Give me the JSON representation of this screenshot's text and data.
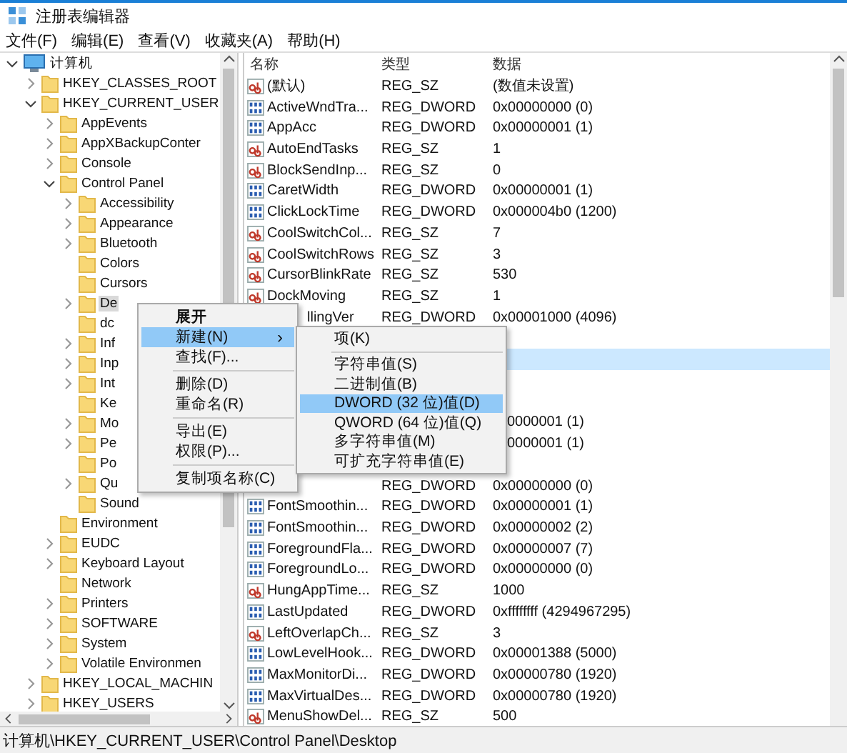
{
  "window": {
    "title": "注册表编辑器"
  },
  "menu_bar": [
    "文件(F)",
    "编辑(E)",
    "查看(V)",
    "收藏夹(A)",
    "帮助(H)"
  ],
  "tree": [
    {
      "label": "计算机",
      "kind": "computer",
      "expandable": true,
      "expanded": true,
      "selected": false,
      "children": [
        {
          "label": "HKEY_CLASSES_ROOT",
          "expandable": true,
          "expanded": false,
          "selected": false
        },
        {
          "label": "HKEY_CURRENT_USER",
          "expandable": true,
          "expanded": true,
          "selected": false,
          "children": [
            {
              "label": "AppEvents",
              "expandable": true,
              "expanded": false,
              "selected": false
            },
            {
              "label": "AppXBackupConter",
              "expandable": true,
              "expanded": false,
              "selected": false
            },
            {
              "label": "Console",
              "expandable": true,
              "expanded": false,
              "selected": false
            },
            {
              "label": "Control Panel",
              "expandable": true,
              "expanded": true,
              "selected": false,
              "children": [
                {
                  "label": "Accessibility",
                  "expandable": true,
                  "expanded": false,
                  "selected": false
                },
                {
                  "label": "Appearance",
                  "expandable": true,
                  "expanded": false,
                  "selected": false
                },
                {
                  "label": "Bluetooth",
                  "expandable": true,
                  "expanded": false,
                  "selected": false
                },
                {
                  "label": "Colors",
                  "expandable": false,
                  "selected": false
                },
                {
                  "label": "Cursors",
                  "expandable": false,
                  "selected": false
                },
                {
                  "label": "De",
                  "expandable": true,
                  "expanded": false,
                  "selected": true
                },
                {
                  "label": "dc",
                  "expandable": false,
                  "selected": false
                },
                {
                  "label": "Inf",
                  "expandable": true,
                  "expanded": false,
                  "selected": false
                },
                {
                  "label": "Inp",
                  "expandable": true,
                  "expanded": false,
                  "selected": false
                },
                {
                  "label": "Int",
                  "expandable": true,
                  "expanded": false,
                  "selected": false
                },
                {
                  "label": "Ke",
                  "expandable": false,
                  "selected": false
                },
                {
                  "label": "Mo",
                  "expandable": true,
                  "expanded": false,
                  "selected": false
                },
                {
                  "label": "Pe",
                  "expandable": true,
                  "expanded": false,
                  "selected": false
                },
                {
                  "label": "Po",
                  "expandable": false,
                  "selected": false
                },
                {
                  "label": "Qu",
                  "expandable": true,
                  "expanded": false,
                  "selected": false
                },
                {
                  "label": "Sound",
                  "expandable": false,
                  "selected": false
                }
              ]
            },
            {
              "label": "Environment",
              "expandable": false,
              "selected": false
            },
            {
              "label": "EUDC",
              "expandable": true,
              "expanded": false,
              "selected": false
            },
            {
              "label": "Keyboard Layout",
              "expandable": true,
              "expanded": false,
              "selected": false
            },
            {
              "label": "Network",
              "expandable": false,
              "selected": false
            },
            {
              "label": "Printers",
              "expandable": true,
              "expanded": false,
              "selected": false
            },
            {
              "label": "SOFTWARE",
              "expandable": true,
              "expanded": false,
              "selected": false
            },
            {
              "label": "System",
              "expandable": true,
              "expanded": false,
              "selected": false
            },
            {
              "label": "Volatile Environmen",
              "expandable": true,
              "expanded": false,
              "selected": false
            }
          ]
        },
        {
          "label": "HKEY_LOCAL_MACHIN",
          "expandable": true,
          "expanded": false,
          "selected": false
        },
        {
          "label": "HKEY_USERS",
          "expandable": true,
          "expanded": false,
          "selected": false
        }
      ]
    }
  ],
  "table": {
    "columns": [
      "名称",
      "类型",
      "数据"
    ],
    "rows": [
      {
        "kind": "string",
        "name": "(默认)",
        "type": "REG_SZ",
        "data": "(数值未设置)",
        "under_menu": false,
        "under_submenu": false,
        "selected": false
      },
      {
        "kind": "binary",
        "name": "ActiveWndTra...",
        "type": "REG_DWORD",
        "data": "0x00000000 (0)",
        "under_menu": false,
        "under_submenu": false,
        "selected": false
      },
      {
        "kind": "binary",
        "name": "AppAcc",
        "type": "REG_DWORD",
        "data": "0x00000001 (1)",
        "under_menu": false,
        "under_submenu": false,
        "selected": false
      },
      {
        "kind": "string",
        "name": "AutoEndTasks",
        "type": "REG_SZ",
        "data": "1",
        "under_menu": false,
        "under_submenu": false,
        "selected": false
      },
      {
        "kind": "string",
        "name": "BlockSendInp...",
        "type": "REG_SZ",
        "data": "0",
        "under_menu": false,
        "under_submenu": false,
        "selected": false
      },
      {
        "kind": "binary",
        "name": "CaretWidth",
        "type": "REG_DWORD",
        "data": "0x00000001 (1)",
        "under_menu": false,
        "under_submenu": false,
        "selected": false
      },
      {
        "kind": "binary",
        "name": "ClickLockTime",
        "type": "REG_DWORD",
        "data": "0x000004b0 (1200)",
        "under_menu": false,
        "under_submenu": false,
        "selected": false
      },
      {
        "kind": "string",
        "name": "CoolSwitchCol...",
        "type": "REG_SZ",
        "data": "7",
        "under_menu": false,
        "under_submenu": false,
        "selected": false
      },
      {
        "kind": "string",
        "name": "CoolSwitchRows",
        "type": "REG_SZ",
        "data": "3",
        "under_menu": false,
        "under_submenu": false,
        "selected": false
      },
      {
        "kind": "string",
        "name": "CursorBlinkRate",
        "type": "REG_SZ",
        "data": "530",
        "under_menu": false,
        "under_submenu": false,
        "selected": false
      },
      {
        "kind": "string",
        "name": "DockMoving",
        "type": "REG_SZ",
        "data": "1",
        "under_menu": false,
        "under_submenu": false,
        "selected": false
      },
      {
        "name": "llingVer",
        "type": "REG_DWORD",
        "data": "0x00001000 (4096)",
        "under_menu": true,
        "under_submenu": false,
        "selected": false
      },
      {
        "selected": false
      },
      {
        "selected": true
      },
      {
        "selected": false
      },
      {
        "selected": false
      },
      {
        "data": "0000001 (1)",
        "under_submenu": true,
        "selected": false
      },
      {
        "data": "0000001 (1)",
        "under_submenu": true,
        "selected": false
      },
      {
        "selected": false
      },
      {
        "type": "REG_DWORD",
        "data": "0x00000000 (0)",
        "under_submenu": false,
        "selected": false
      },
      {
        "kind": "binary",
        "name": "FontSmoothin...",
        "type": "REG_DWORD",
        "data": "0x00000001 (1)",
        "under_menu": false,
        "under_submenu": false,
        "selected": false
      },
      {
        "kind": "binary",
        "name": "FontSmoothin...",
        "type": "REG_DWORD",
        "data": "0x00000002 (2)",
        "under_menu": false,
        "under_submenu": false,
        "selected": false
      },
      {
        "kind": "binary",
        "name": "ForegroundFla...",
        "type": "REG_DWORD",
        "data": "0x00000007 (7)",
        "under_menu": false,
        "under_submenu": false,
        "selected": false
      },
      {
        "kind": "binary",
        "name": "ForegroundLo...",
        "type": "REG_DWORD",
        "data": "0x00000000 (0)",
        "under_menu": false,
        "under_submenu": false,
        "selected": false
      },
      {
        "kind": "string",
        "name": "HungAppTime...",
        "type": "REG_SZ",
        "data": "1000",
        "under_menu": false,
        "under_submenu": false,
        "selected": false
      },
      {
        "kind": "binary",
        "name": "LastUpdated",
        "type": "REG_DWORD",
        "data": "0xffffffff (4294967295)",
        "under_menu": false,
        "under_submenu": false,
        "selected": false
      },
      {
        "kind": "string",
        "name": "LeftOverlapCh...",
        "type": "REG_SZ",
        "data": "3",
        "under_menu": false,
        "under_submenu": false,
        "selected": false
      },
      {
        "kind": "binary",
        "name": "LowLevelHook...",
        "type": "REG_DWORD",
        "data": "0x00001388 (5000)",
        "under_menu": false,
        "under_submenu": false,
        "selected": false
      },
      {
        "kind": "binary",
        "name": "MaxMonitorDi...",
        "type": "REG_DWORD",
        "data": "0x00000780 (1920)",
        "under_menu": false,
        "under_submenu": false,
        "selected": false
      },
      {
        "kind": "binary",
        "name": "MaxVirtualDes...",
        "type": "REG_DWORD",
        "data": "0x00000780 (1920)",
        "under_menu": false,
        "under_submenu": false,
        "selected": false
      },
      {
        "kind": "string",
        "name": "MenuShowDel...",
        "type": "REG_SZ",
        "data": "500",
        "under_menu": false,
        "under_submenu": false,
        "selected": false
      }
    ]
  },
  "context_menu": {
    "groups": [
      [
        {
          "label": "展开",
          "kind": "default",
          "selected": false
        },
        {
          "label": "新建(N)",
          "kind": "submenu",
          "arrow": "›",
          "selected": true
        },
        {
          "label": "查找(F)...",
          "kind": "plain",
          "selected": false
        }
      ],
      [
        {
          "label": "删除(D)",
          "kind": "plain",
          "selected": false
        },
        {
          "label": "重命名(R)",
          "kind": "plain",
          "selected": false
        }
      ],
      [
        {
          "label": "导出(E)",
          "kind": "plain",
          "selected": false
        },
        {
          "label": "权限(P)...",
          "kind": "plain",
          "selected": false
        }
      ],
      [
        {
          "label": "复制项名称(C)",
          "kind": "plain",
          "selected": false
        }
      ]
    ]
  },
  "submenu": {
    "groups": [
      [
        {
          "label": "项(K)",
          "selected": false
        }
      ],
      [
        {
          "label": "字符串值(S)",
          "selected": false
        },
        {
          "label": "二进制值(B)",
          "selected": false
        },
        {
          "label": "DWORD (32 位)值(D)",
          "selected": true
        },
        {
          "label": "QWORD (64 位)值(Q)",
          "selected": false
        },
        {
          "label": "多字符串值(M)",
          "selected": false
        },
        {
          "label": "可扩充字符串值(E)",
          "selected": false
        }
      ]
    ]
  },
  "status_bar": "计算机\\HKEY_CURRENT_USER\\Control Panel\\Desktop"
}
